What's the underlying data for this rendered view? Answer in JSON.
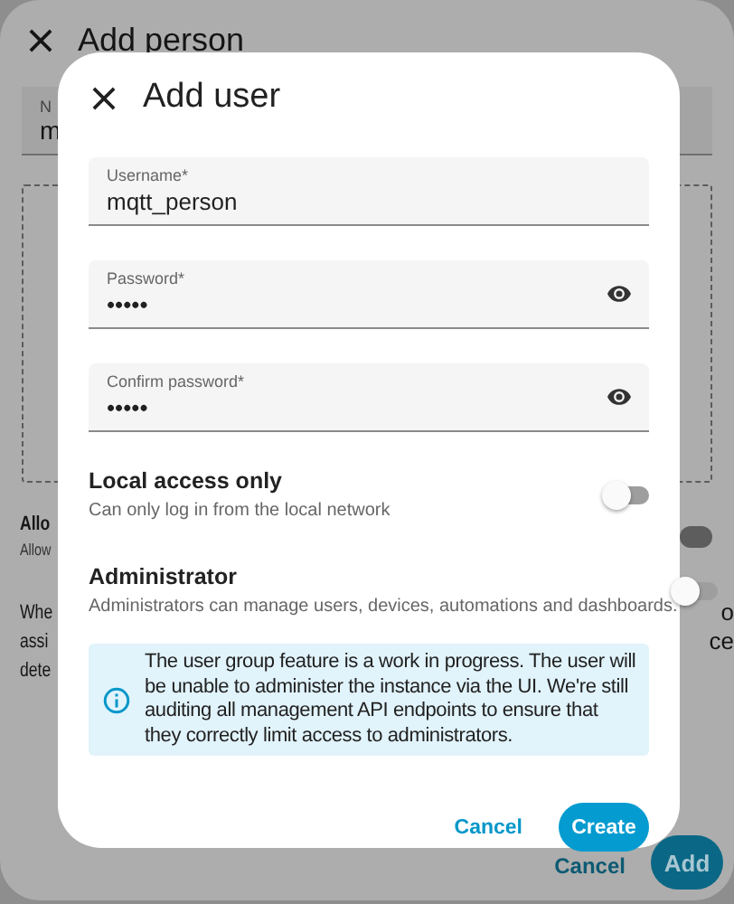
{
  "background_dialog": {
    "title": "Add person",
    "name_field": {
      "label": "N",
      "value": "m"
    },
    "allow_row": {
      "title": "Allo",
      "subtitle": "Allow"
    },
    "paragraph": [
      {
        "left": "Whe",
        "right": "o"
      },
      {
        "left": "assi",
        "right": "ce"
      },
      {
        "left": "dete"
      }
    ],
    "buttons": [
      {
        "label": "Cancel",
        "kind": "text"
      },
      {
        "label": "Add",
        "kind": "filled"
      }
    ]
  },
  "dialog": {
    "title": "Add user",
    "fields": [
      {
        "label": "Username*",
        "value": "mqtt_person",
        "kind": "text"
      },
      {
        "label": "Password*",
        "value": "•••••",
        "kind": "password"
      },
      {
        "label": "Confirm password*",
        "value": "•••••",
        "kind": "password"
      }
    ],
    "toggles": [
      {
        "title": "Local access only",
        "subtitle": "Can only log in from the local network",
        "on": false
      },
      {
        "title": "Administrator",
        "subtitle": "Administrators can manage users, devices, automations and dashboards.",
        "on": false
      }
    ],
    "alert": {
      "text": "The user group feature is a work in progress. The user will be unable to administer the instance via the UI. We're still auditing all management API endpoints to ensure that they correctly limit access to administrators."
    },
    "buttons": [
      {
        "label": "Cancel",
        "kind": "text"
      },
      {
        "label": "Create",
        "kind": "filled"
      }
    ]
  }
}
